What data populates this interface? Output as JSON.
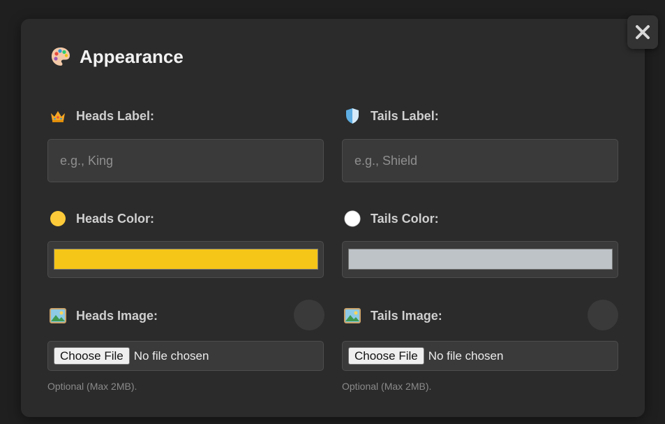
{
  "close": {
    "icon": "close-icon"
  },
  "header": {
    "title": "Appearance",
    "icon": "palette-icon"
  },
  "heads": {
    "label_title": "Heads Label:",
    "label_icon": "crown-icon",
    "label_placeholder": "e.g., King",
    "color_title": "Heads Color:",
    "color_icon": "yellow-circle-icon",
    "color_value": "#f5c518",
    "image_title": "Heads Image:",
    "image_icon": "picture-icon",
    "file_button": "Choose File",
    "file_status": "No file chosen",
    "hint": "Optional (Max 2MB)."
  },
  "tails": {
    "label_title": "Tails Label:",
    "label_icon": "shield-icon",
    "label_placeholder": "e.g., Shield",
    "color_title": "Tails Color:",
    "color_icon": "white-circle-icon",
    "color_value": "#bdc3c7",
    "image_title": "Tails Image:",
    "image_icon": "picture-icon",
    "file_button": "Choose File",
    "file_status": "No file chosen",
    "hint": "Optional (Max 2MB)."
  }
}
